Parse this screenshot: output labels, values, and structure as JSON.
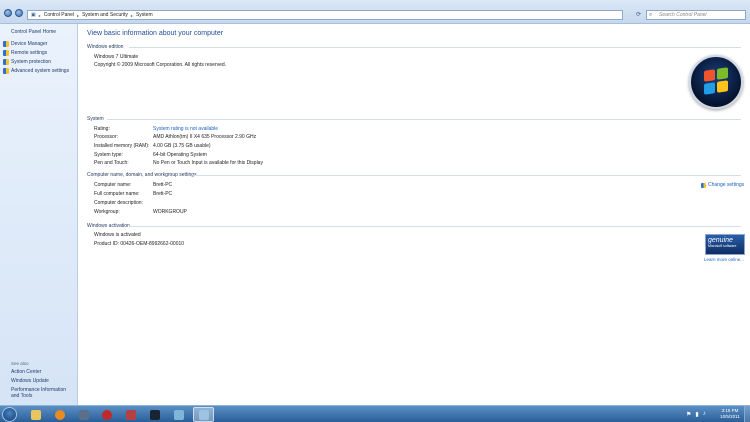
{
  "address": {
    "crumbs": [
      "Control Panel",
      "System and Security",
      "System"
    ],
    "search_placeholder": "Search Control Panel"
  },
  "sidebar": {
    "home": "Control Panel Home",
    "items": [
      "Device Manager",
      "Remote settings",
      "System protection",
      "Advanced system settings"
    ],
    "see_also": "See also",
    "see_links": [
      "Action Center",
      "Windows Update",
      "Performance Information and Tools"
    ]
  },
  "main": {
    "title": "View basic information about your computer",
    "edition": {
      "heading": "Windows edition",
      "name": "Windows 7 Ultimate",
      "copyright": "Copyright © 2009 Microsoft Corporation.  All rights reserved."
    },
    "system": {
      "heading": "System",
      "rows": [
        {
          "label": "Rating:",
          "value": "System rating is not available"
        },
        {
          "label": "Processor:",
          "value": "AMD Athlon(tm) II X4 635 Processor   2.90 GHz"
        },
        {
          "label": "Installed memory (RAM):",
          "value": "4.00 GB (3.75 GB usable)"
        },
        {
          "label": "System type:",
          "value": "64-bit Operating System"
        },
        {
          "label": "Pen and Touch:",
          "value": "No Pen or Touch Input is available for this Display"
        }
      ]
    },
    "computer": {
      "heading": "Computer name, domain, and workgroup settings",
      "change_link": "Change settings",
      "rows": [
        {
          "label": "Computer name:",
          "value": "Brett-PC"
        },
        {
          "label": "Full computer name:",
          "value": "Brett-PC"
        },
        {
          "label": "Computer description:",
          "value": ""
        },
        {
          "label": "Workgroup:",
          "value": "WORKGROUP"
        }
      ]
    },
    "activation": {
      "heading": "Windows activation",
      "status": "Windows is activated",
      "product_id": "Product ID: 00426-OEM-8992662-00010",
      "genuine_1": "genuine",
      "genuine_2": "Microsoft software",
      "learn_more": "Learn more online..."
    }
  },
  "taskbar": {
    "time": "3:15 PM",
    "date": "10/5/2011"
  },
  "colors": {
    "link": "#1b62c4",
    "title": "#1e4e98",
    "taskbar": "#2b5e98"
  }
}
